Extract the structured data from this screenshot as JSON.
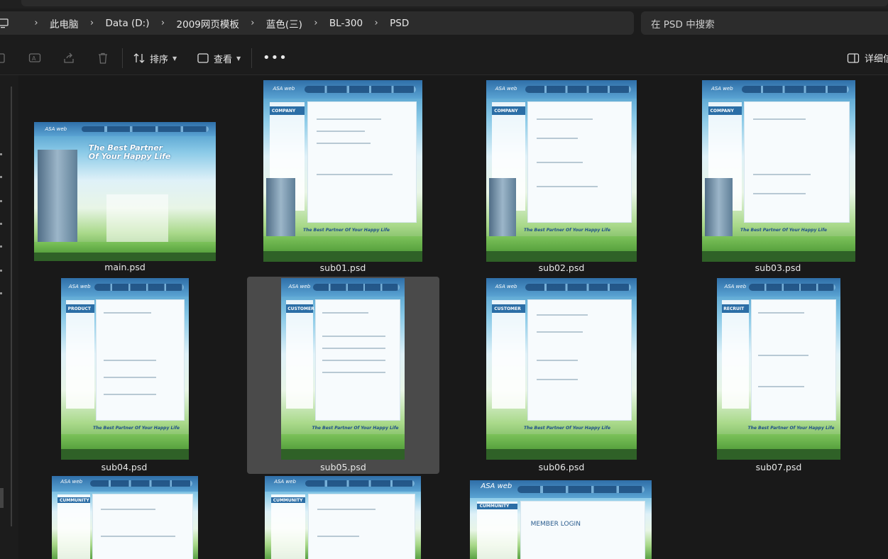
{
  "breadcrumb": {
    "items": [
      "此电脑",
      "Data (D:)",
      "2009网页模板",
      "蓝色(三)",
      "BL-300",
      "PSD"
    ]
  },
  "search": {
    "placeholder": "在 PSD 中搜索"
  },
  "toolbar": {
    "sort_label": "排序",
    "view_label": "查看",
    "details_label": "详细信"
  },
  "files": [
    {
      "name": "main.psd",
      "section": ""
    },
    {
      "name": "sub01.psd",
      "section": "COMPANY"
    },
    {
      "name": "sub02.psd",
      "section": "COMPANY"
    },
    {
      "name": "sub03.psd",
      "section": "COMPANY"
    },
    {
      "name": "sub04.psd",
      "section": "PRODUCT"
    },
    {
      "name": "sub05.psd",
      "section": "CUSTOMER"
    },
    {
      "name": "sub06.psd",
      "section": "CUSTOMER"
    },
    {
      "name": "sub07.psd",
      "section": "RECRUIT"
    },
    {
      "name": "",
      "section": "CUMMUNITY"
    },
    {
      "name": "",
      "section": "CUMMUNITY"
    },
    {
      "name": "",
      "section": "CUMMUNITY"
    }
  ],
  "thumb_text": {
    "logo": "ASA web",
    "hero_line1": "The Best Partner",
    "hero_line2": "Of Your Happy Life",
    "slogan": "The Best Partner Of Your Happy Life",
    "member_login": "MEMBER LOGIN"
  },
  "selected_file": "sub05.psd",
  "colors": {
    "accent_bg": "#1c1c1c",
    "selection": "#4a4a4a"
  }
}
